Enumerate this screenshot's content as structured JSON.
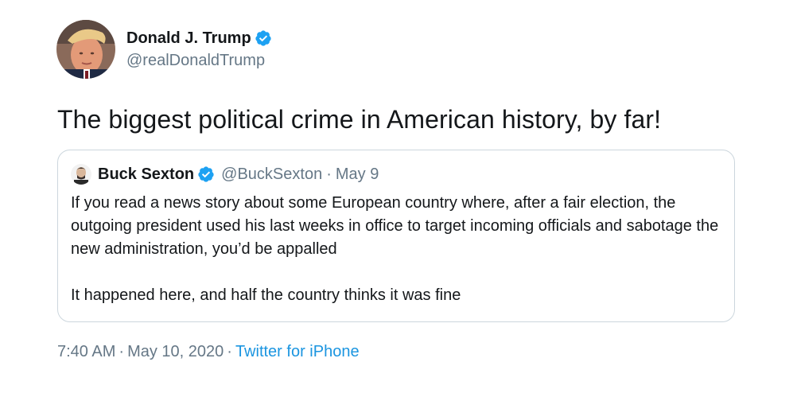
{
  "tweet": {
    "author": {
      "name": "Donald J. Trump",
      "handle": "@realDonaldTrump",
      "verified": true,
      "avatar_icon": "profile-photo"
    },
    "text": "The biggest political crime in American history, by far!",
    "quoted": {
      "author": {
        "name": "Buck Sexton",
        "handle": "@BuckSexton",
        "verified": true,
        "avatar_icon": "profile-photo"
      },
      "separator": "·",
      "date": "May 9",
      "paragraphs": [
        "If you read a news story about some European country where, after a fair election, the outgoing president used his last weeks in office to target incoming officials and sabotage the new administration, you’d be appalled",
        "It happened here, and half the country thinks it was fine"
      ]
    },
    "meta": {
      "time": "7:40 AM",
      "separator": "·",
      "date": "May 10, 2020",
      "source": "Twitter for iPhone"
    }
  },
  "colors": {
    "verified_blue": "#1da1f2",
    "secondary_text": "#657786",
    "link": "#1b95e0",
    "border": "#ccd6dd"
  }
}
